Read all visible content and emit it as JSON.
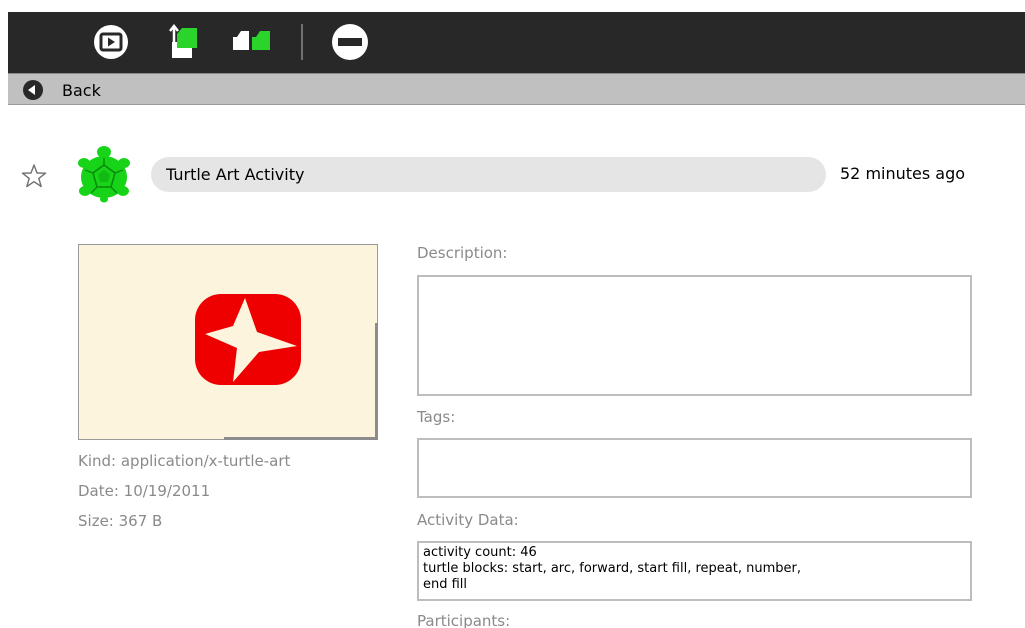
{
  "toolbar": {
    "buttons": [
      {
        "icon": "resume-play-icon"
      },
      {
        "icon": "copy-to-clipboard-icon"
      },
      {
        "icon": "duplicate-icon"
      },
      {
        "icon": "erase-remove-icon"
      }
    ],
    "colors": {
      "background": "#282828",
      "accent_green": "#2ad42a"
    }
  },
  "backbar": {
    "back_label": "Back"
  },
  "entry": {
    "starred": false,
    "activity_icon": "turtle-art-icon",
    "title": "Turtle Art Activity",
    "time_ago": "52 minutes ago"
  },
  "preview": {
    "image": "red-star-preview",
    "background": "#fdf4de",
    "shape_color": "#ee0000"
  },
  "meta": {
    "kind": "Kind: application/x-turtle-art",
    "date": "Date: 10/19/2011",
    "size": "Size: 367 B"
  },
  "fields": {
    "description_label": "Description:",
    "description_value": "",
    "tags_label": "Tags:",
    "tags_value": "",
    "activity_data_label": "Activity Data:",
    "activity_data_lines": [
      "activity count: 46",
      "turtle blocks: start, arc, forward, start fill, repeat, number,",
      "end fill"
    ],
    "participants_label": "Participants:"
  }
}
